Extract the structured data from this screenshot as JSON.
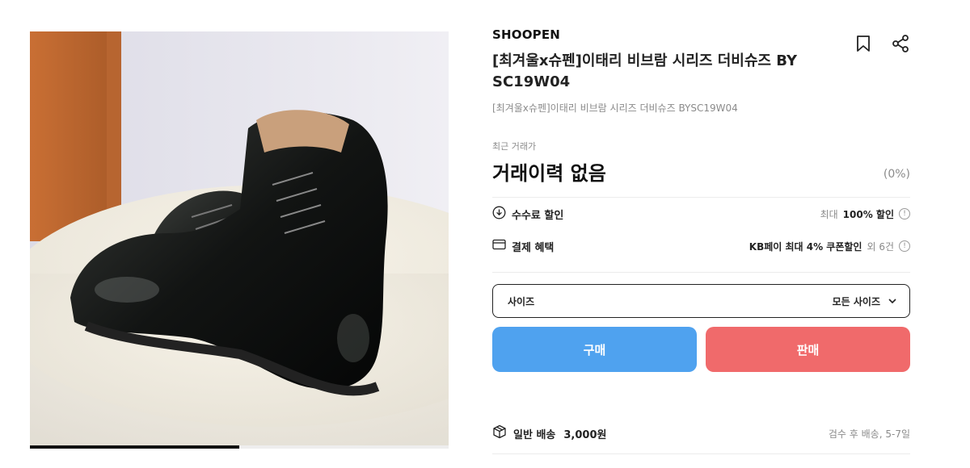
{
  "product": {
    "brand": "SHOOPEN",
    "title": "[최겨울x슈펜]이태리 비브람 시리즈 더비슈즈 BY SC19W04",
    "subtitle": "[최겨울x슈펜]이태리 비브람 시리즈 더비슈즈 BYSC19W04",
    "image_progress": 0.5
  },
  "price": {
    "label": "최근 거래가",
    "value": "거래이력 없음",
    "change": "(0%)"
  },
  "benefits": [
    {
      "icon": "download-circle-icon",
      "label": "수수료 할인",
      "prefix": "최대",
      "highlight": "100% 할인",
      "suffix": ""
    },
    {
      "icon": "card-icon",
      "label": "결제 혜택",
      "prefix": "",
      "highlight": "KB페이 최대 4% 쿠폰할인",
      "suffix": "외 6건"
    }
  ],
  "size": {
    "label": "사이즈",
    "value": "모든 사이즈"
  },
  "actions": {
    "buy": "구매",
    "sell": "판매"
  },
  "delivery": {
    "label": "일반 배송",
    "fee": "3,000원",
    "note": "검수 후 배송, 5-7일"
  },
  "icons": {
    "bookmark": "bookmark-icon",
    "share": "share-icon",
    "info": "info-icon",
    "chevron": "chevron-down-icon",
    "box": "box-icon"
  },
  "colors": {
    "buy": "#4fa2ef",
    "sell": "#f06a6b"
  }
}
